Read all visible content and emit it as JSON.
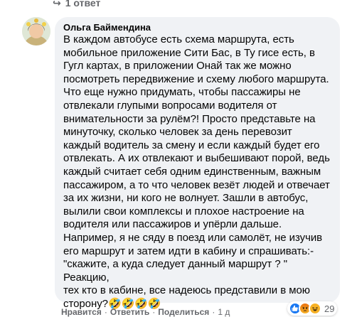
{
  "thread": {
    "prev_reply_label": "1 ответ"
  },
  "comment": {
    "author": "Ольга Баймендина",
    "text": "В каждом автобусе есть схема маршрута, есть\nмобильное приложение Сити Бас, в Ту гисе есть, в\nГугл картах, в приложении Онай так же можно\nпосмотреть передвижение и схему любого маршрута.\nЧто еще нужно придумать, чтобы пассажиры не\nотвлекали глупыми вопросами водителя от\nвнимательности за рулём?! Просто представьте на\nминуточку, сколько человек за день перевозит\nкаждый водитель за смену и если каждый будет его\nотвлекать. А их отвлекают и выбешивают порой, ведь\nкаждый считает себя одним единственным, важным\nпассажиром, а то что человек везёт людей и отвечает\nза их жизни, ни кого не волнует. Зашли в автобус,\nвылили свои комплексы и плохое настроение на\nводителя или пассажиров и упёрли дальше.\nНапример, я не сяду в поезд или самолёт, не изучив\nего маршрут и затем идти в кабину и спрашивать:-\n\"скажите, а куда следует данный маршрут ? \" Реакцию,\nтех кто в кабине, все надеюсь представили в мою\nсторону?",
    "emoji_suffix": "🤣🤣🤣🤣"
  },
  "actions": {
    "like": "Нравится",
    "reply": "Ответить",
    "share": "Поделиться",
    "time": "1 д",
    "separator": "·"
  },
  "reactions": {
    "count": "29",
    "types": [
      "like-icon",
      "angry-icon",
      "haha-icon"
    ],
    "colors": {
      "like": "#1877f2",
      "angry": "#e9710f",
      "haha": "#f7b125"
    }
  }
}
